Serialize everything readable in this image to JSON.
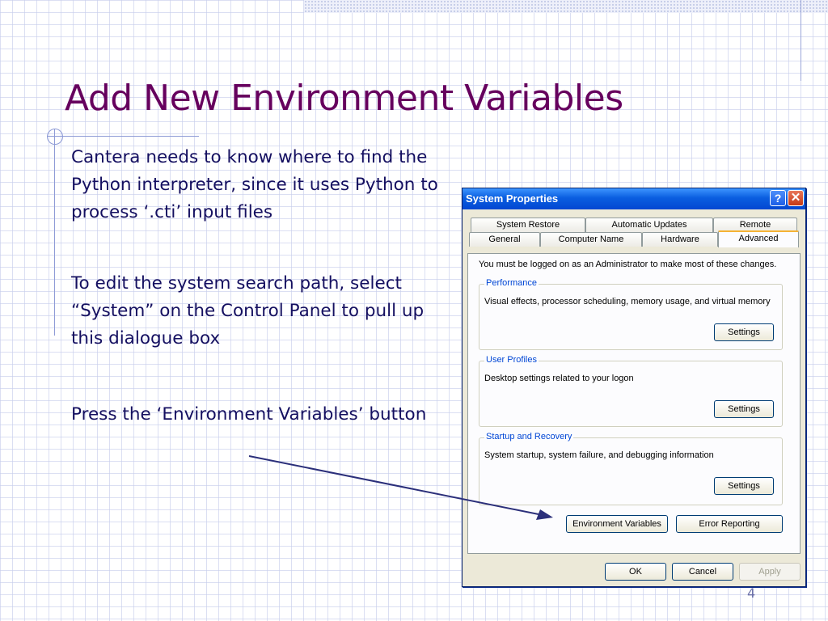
{
  "slide": {
    "title": "Add New Environment Variables",
    "bullets": [
      "Cantera needs to know where to find the Python interpreter, since it uses Python to process ‘.cti’ input files",
      "To edit the system search path, select “System” on the Control Panel to pull up this dialogue box",
      "Press the ‘Environment Variables’ button"
    ],
    "page_number": "4",
    "colors": {
      "title": "#66005e",
      "body_text": "#140f60",
      "arrow": "#2b2f7a",
      "grid": "#c8ceec"
    }
  },
  "dialog": {
    "title": "System Properties",
    "help_glyph": "?",
    "close_glyph": "✕",
    "tabs_back": [
      "System Restore",
      "Automatic Updates",
      "Remote"
    ],
    "tabs_front": [
      "General",
      "Computer Name",
      "Hardware",
      "Advanced"
    ],
    "active_tab": "Advanced",
    "admin_note": "You must be logged on as an Administrator to make most of these changes.",
    "groups": [
      {
        "title": "Performance",
        "description": "Visual effects, processor scheduling, memory usage, and virtual memory",
        "button": "Settings"
      },
      {
        "title": "User Profiles",
        "description": "Desktop settings related to your logon",
        "button": "Settings"
      },
      {
        "title": "Startup and Recovery",
        "description": "System startup, system failure, and debugging information",
        "button": "Settings"
      }
    ],
    "env_button": "Environment Variables",
    "error_button": "Error Reporting",
    "ok_button": "OK",
    "cancel_button": "Cancel",
    "apply_button": "Apply",
    "colors": {
      "titlebar": "#0a5ee0",
      "face": "#ece9d8",
      "group_title": "#0046d5",
      "active_tab_accent": "#f5b335"
    }
  }
}
